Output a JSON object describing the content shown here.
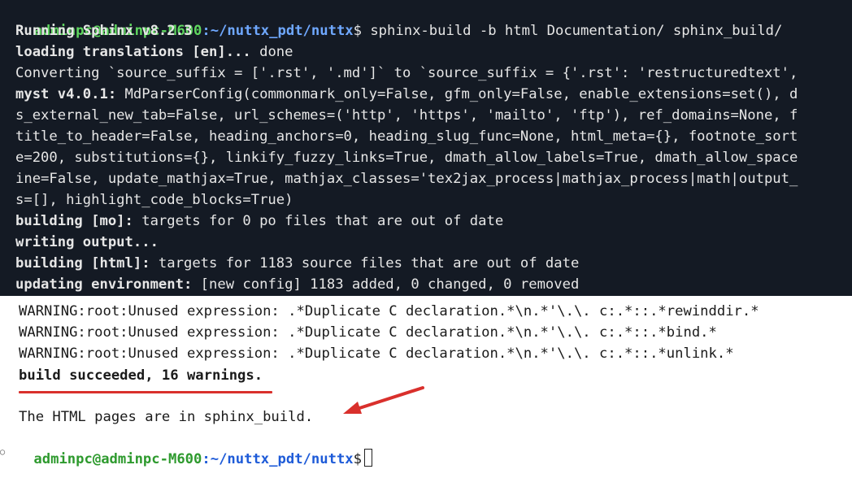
{
  "terminal_top": {
    "prompt": {
      "user_host": "adminpc@adminpc-M600",
      "path": ":~/nuttx_pdt/nuttx",
      "command": "$ sphinx-build -b html Documentation/ sphinx_build/"
    },
    "lines": [
      {
        "bold": "Running Sphinx v8.2.3",
        "rest": ""
      },
      {
        "bold": "loading translations [en]... ",
        "rest": "done"
      },
      {
        "bold": "",
        "rest": "Converting `source_suffix = ['.rst', '.md']` to `source_suffix = {'.rst': 'restructuredtext',"
      },
      {
        "bold": "myst v4.0.1: ",
        "rest": "MdParserConfig(commonmark_only=False, gfm_only=False, enable_extensions=set(), d"
      },
      {
        "bold": "",
        "rest": "s_external_new_tab=False, url_schemes=('http', 'https', 'mailto', 'ftp'), ref_domains=None, f"
      },
      {
        "bold": "",
        "rest": "title_to_header=False, heading_anchors=0, heading_slug_func=None, html_meta={}, footnote_sort"
      },
      {
        "bold": "",
        "rest": "e=200, substitutions={}, linkify_fuzzy_links=True, dmath_allow_labels=True, dmath_allow_space"
      },
      {
        "bold": "",
        "rest": "ine=False, update_mathjax=True, mathjax_classes='tex2jax_process|mathjax_process|math|output_"
      },
      {
        "bold": "",
        "rest": "s=[], highlight_code_blocks=True)"
      },
      {
        "bold": "building [mo]: ",
        "rest": "targets for 0 po files that are out of date"
      },
      {
        "bold": "writing output... ",
        "rest": ""
      },
      {
        "bold": "building [html]: ",
        "rest": "targets for 1183 source files that are out of date"
      },
      {
        "bold": "updating environment: ",
        "rest": "[new config] 1183 added, 0 changed, 0 removed"
      }
    ]
  },
  "terminal_bottom": {
    "warnings": [
      "WARNING:root:Unused expression: .*Duplicate C declaration.*\\n.*'\\.\\. c:.*::.*rewinddir.*",
      "WARNING:root:Unused expression: .*Duplicate C declaration.*\\n.*'\\.\\. c:.*::.*bind.*",
      "WARNING:root:Unused expression: .*Duplicate C declaration.*\\n.*'\\.\\. c:.*::.*unlink.*"
    ],
    "build_result": "build succeeded, 16 warnings.",
    "html_location": "The HTML pages are in sphinx_build.",
    "prompt": {
      "user_host": "adminpc@adminpc-M600",
      "path": ":~/nuttx_pdt/nuttx",
      "symbol": "$"
    }
  },
  "annotations": {
    "underline_color": "#d9302c",
    "arrow_color": "#d9302c",
    "arrow_icon": "red-arrow-icon"
  },
  "colors": {
    "terminal_bg": "#141a24",
    "prompt_user": "#5fd75f",
    "prompt_path": "#6fa8ff"
  }
}
